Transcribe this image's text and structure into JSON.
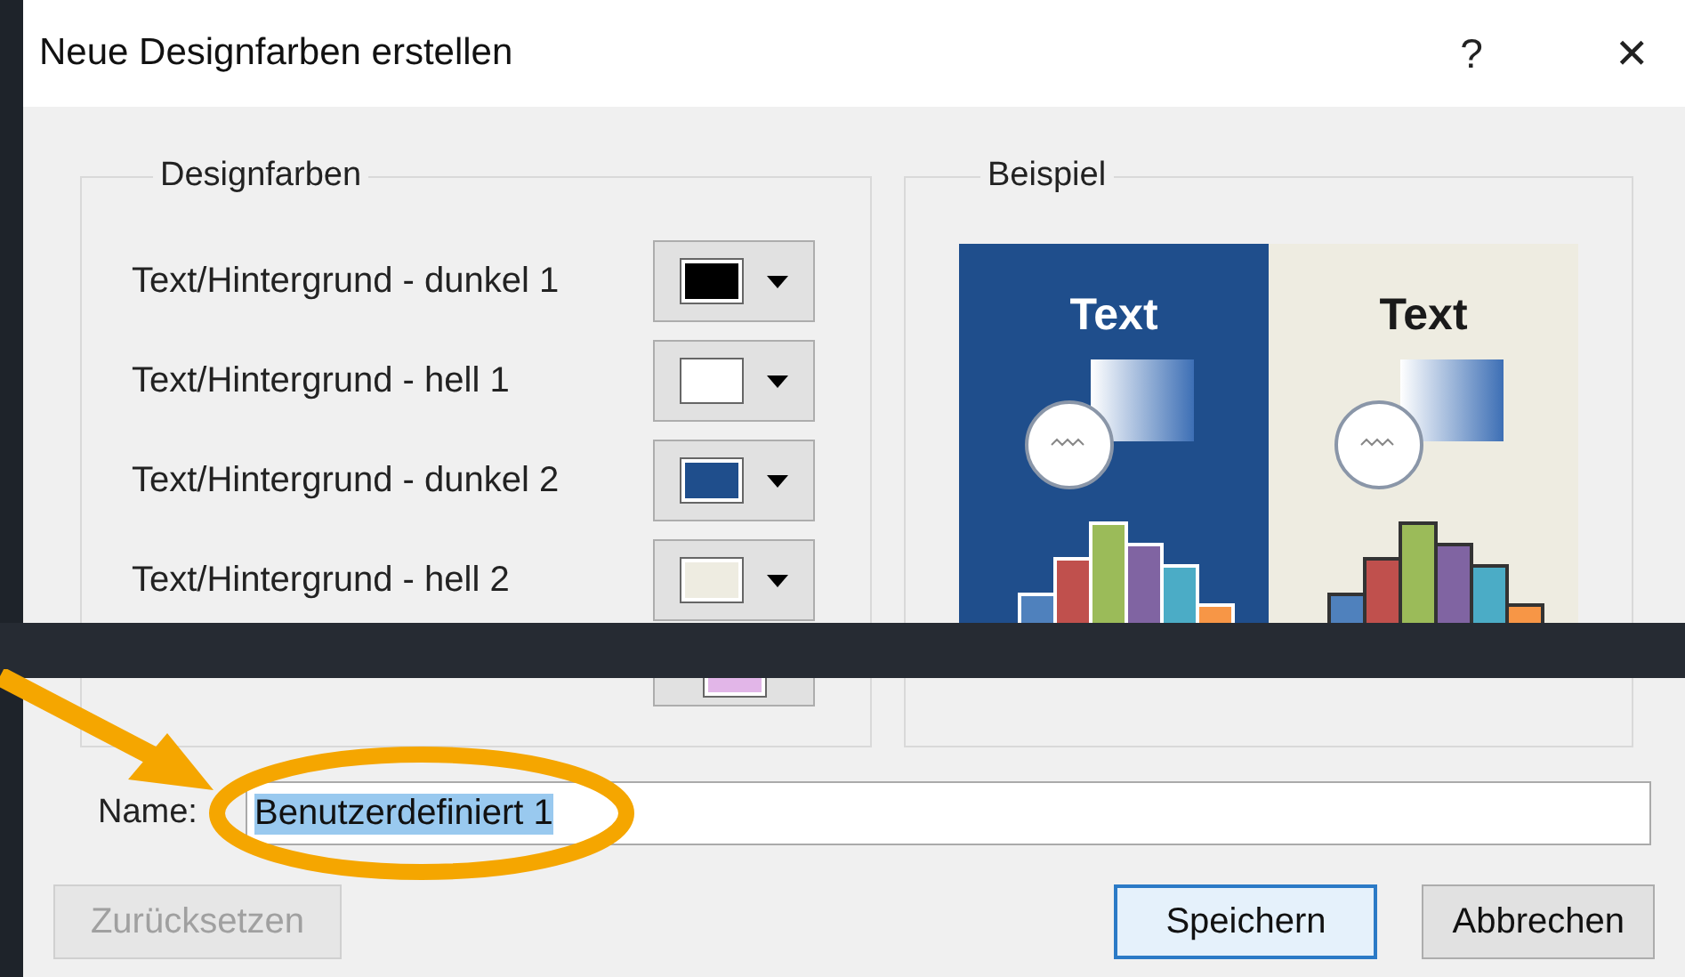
{
  "window": {
    "title": "Neue Designfarben erstellen",
    "help": "?",
    "close": "✕"
  },
  "design_colors": {
    "title": "Designfarben",
    "rows": [
      {
        "label": "Text/Hintergrund - dunkel 1",
        "color": "#000000"
      },
      {
        "label": "Text/Hintergrund - hell 1",
        "color": "#ffffff"
      },
      {
        "label": "Text/Hintergrund - dunkel 2",
        "color": "#1f4e8c"
      },
      {
        "label": "Text/Hintergrund - hell 2",
        "color": "#eeece1"
      },
      {
        "color": "#e2b6e8"
      }
    ]
  },
  "example": {
    "title": "Beispiel",
    "panels": [
      {
        "text": "Text",
        "kind": "dark"
      },
      {
        "text": "Text",
        "kind": "light"
      }
    ]
  },
  "name": {
    "label": "Name:",
    "value": "Benutzerdefiniert 1",
    "text_selected": true
  },
  "buttons": [
    {
      "label": "Zurücksetzen",
      "disabled": true,
      "focused": false
    },
    {
      "label": "Speichern",
      "disabled": false,
      "focused": true
    },
    {
      "label": "Abbrechen",
      "disabled": false,
      "focused": false
    }
  ]
}
